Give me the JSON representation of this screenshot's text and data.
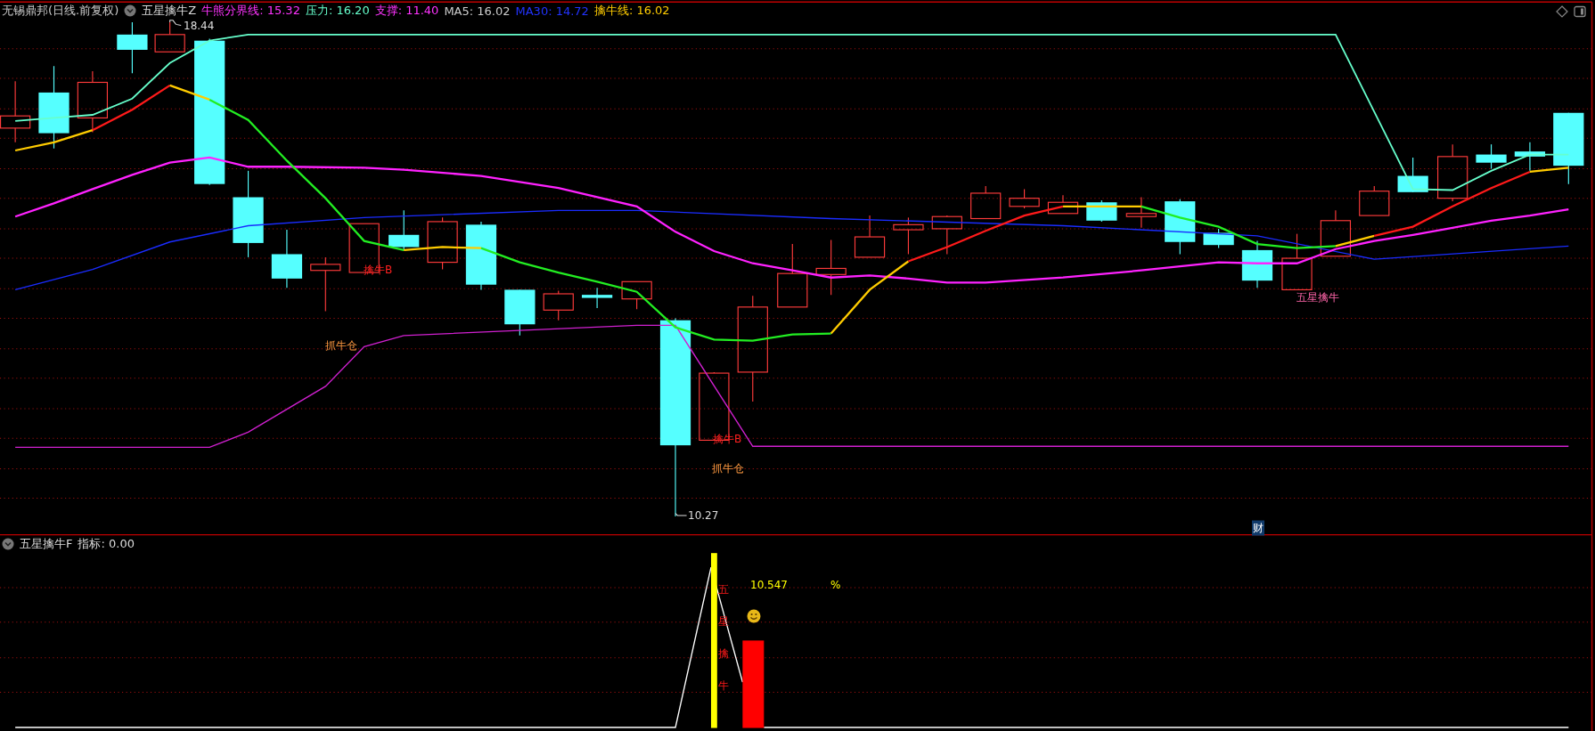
{
  "header": {
    "title": "无锡鼎邦(日线.前复权)",
    "indicator": "五星擒牛Z",
    "values": [
      {
        "label": "牛熊分界线: 15.32",
        "color": "#ff33ff"
      },
      {
        "label": "压力: 16.20",
        "color": "#66ffcc"
      },
      {
        "label": "支撑: 11.40",
        "color": "#ff33ff"
      },
      {
        "label": "MA5: 16.02",
        "color": "#cccccc"
      },
      {
        "label": "MA30: 14.72",
        "color": "#2233ff"
      },
      {
        "label": "擒牛线: 16.02",
        "color": "#ffcc00"
      }
    ]
  },
  "annotations": [
    {
      "kind": "price",
      "text": "18.44"
    },
    {
      "kind": "price",
      "text": "10.27"
    },
    {
      "kind": "buy",
      "text": "擒牛B"
    },
    {
      "kind": "buy",
      "text": "擒牛B"
    },
    {
      "kind": "zone",
      "text": "抓牛仓"
    },
    {
      "kind": "zone",
      "text": "抓牛仓"
    },
    {
      "kind": "signal",
      "text": "五星擒牛"
    },
    {
      "kind": "badge",
      "text": "财"
    }
  ],
  "sub_panel": {
    "indicator": "五星擒牛F",
    "reading": "指标: 0.00",
    "vertical_label": "五星擒牛",
    "value": "10.547",
    "unit": "%"
  }
}
